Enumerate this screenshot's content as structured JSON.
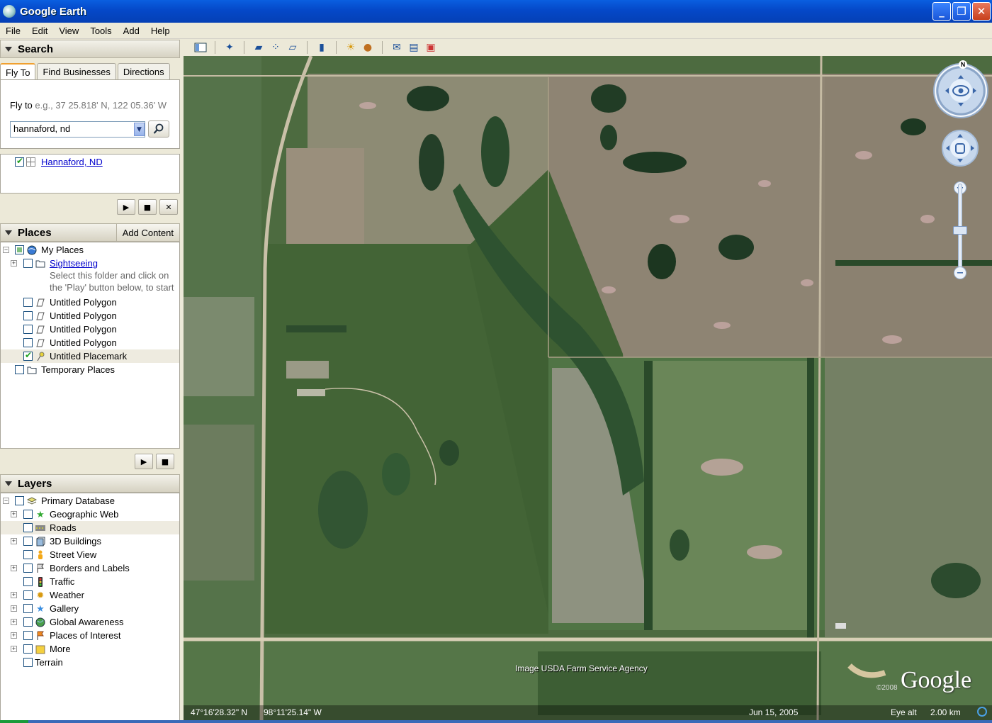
{
  "window": {
    "title": "Google Earth",
    "minimize": "_",
    "maximize": "❐",
    "close": "✕"
  },
  "menu": [
    "File",
    "Edit",
    "View",
    "Tools",
    "Add",
    "Help"
  ],
  "search": {
    "header": "Search",
    "tabs": [
      "Fly To",
      "Find Businesses",
      "Directions"
    ],
    "flyto_label": "Fly to",
    "flyto_hint": "e.g., 37 25.818' N, 122 05.36' W",
    "query": "hannaford, nd",
    "result": "Hannaford, ND"
  },
  "places": {
    "header": "Places",
    "add_content": "Add Content",
    "items": {
      "my_places": "My Places",
      "sightseeing": "Sightseeing",
      "sightseeing_note_1": "Select this folder and click on",
      "sightseeing_note_2": "the 'Play' button below, to start",
      "polygon_1": "Untitled Polygon",
      "polygon_2": "Untitled Polygon",
      "polygon_3": "Untitled Polygon",
      "polygon_4": "Untitled Polygon",
      "placemark": "Untitled Placemark",
      "temporary": "Temporary Places"
    }
  },
  "layers": {
    "header": "Layers",
    "items": {
      "primary": "Primary Database",
      "geographic_web": "Geographic Web",
      "roads": "Roads",
      "buildings": "3D Buildings",
      "street_view": "Street View",
      "borders": "Borders and Labels",
      "traffic": "Traffic",
      "weather": "Weather",
      "gallery": "Gallery",
      "global_awareness": "Global Awareness",
      "places_of_interest": "Places of Interest",
      "more": "More",
      "terrain": "Terrain"
    }
  },
  "map": {
    "attribution": "Image USDA Farm Service Agency",
    "logo": "Google",
    "copyright": "©2008",
    "north": "N",
    "zoom_in": "+",
    "zoom_out": "−"
  },
  "status": {
    "lat": "47°16'28.32\" N",
    "lon": "98°11'25.14\" W",
    "date": "Jun 15, 2005",
    "eye_alt_label": "Eye alt",
    "eye_alt": "2.00 km"
  },
  "colors": {
    "title_bar": "#0a5fe0",
    "panel_bg": "#ece9d8",
    "link": "#0000cc",
    "map_green": "#4b6a3e"
  }
}
